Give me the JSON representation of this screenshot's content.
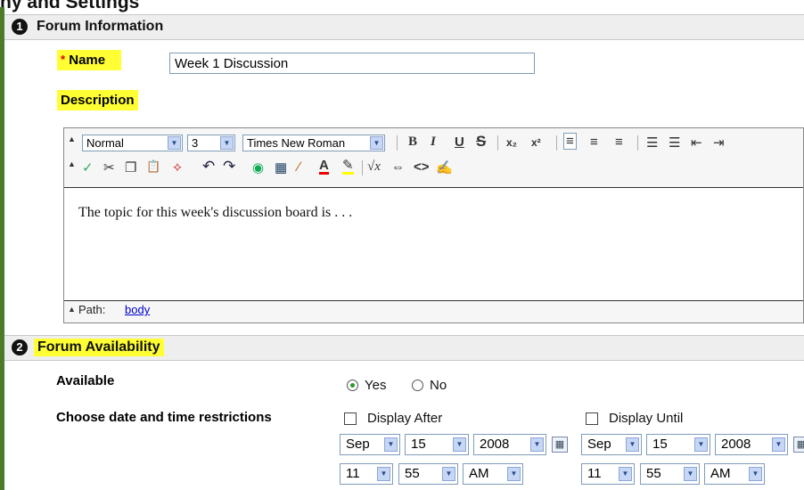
{
  "page_header_fragment": "ny and Settings",
  "section1": {
    "number": "1",
    "title": "Forum Information"
  },
  "name_field": {
    "required_mark": "*",
    "label": "Name",
    "value": "Week 1 Discussion"
  },
  "description": {
    "label": "Description"
  },
  "editor": {
    "format_select": "Normal",
    "size_select": "3",
    "font_select": "Times New Roman",
    "toolbar_row1": [
      {
        "name": "bold-icon",
        "glyph": "B"
      },
      {
        "name": "italic-icon",
        "glyph": "I"
      },
      {
        "name": "underline-icon",
        "glyph": "U"
      },
      {
        "name": "strikethrough-icon",
        "glyph": "S"
      },
      {
        "name": "subscript-icon",
        "glyph": "x₂"
      },
      {
        "name": "superscript-icon",
        "glyph": "x²"
      },
      {
        "name": "align-left-icon",
        "glyph": "≡"
      },
      {
        "name": "align-center-icon",
        "glyph": "≡"
      },
      {
        "name": "align-right-icon",
        "glyph": "≡"
      },
      {
        "name": "numbered-list-icon",
        "glyph": "☰"
      },
      {
        "name": "bullet-list-icon",
        "glyph": "☰"
      },
      {
        "name": "outdent-icon",
        "glyph": "⇤"
      },
      {
        "name": "indent-icon",
        "glyph": "⇥"
      }
    ],
    "toolbar_row2": [
      {
        "name": "spellcheck-icon",
        "glyph": "✓"
      },
      {
        "name": "cut-icon",
        "glyph": "✂"
      },
      {
        "name": "copy-icon",
        "glyph": "❐"
      },
      {
        "name": "paste-icon",
        "glyph": "📋"
      },
      {
        "name": "link-icon",
        "glyph": "⟡"
      },
      {
        "name": "undo-icon",
        "glyph": "↶"
      },
      {
        "name": "redo-icon",
        "glyph": "↷"
      },
      {
        "name": "image-icon",
        "glyph": "◉"
      },
      {
        "name": "table-icon",
        "glyph": "▦"
      },
      {
        "name": "line-icon",
        "glyph": "∕"
      },
      {
        "name": "text-color-icon",
        "glyph": "A"
      },
      {
        "name": "highlight-icon",
        "glyph": "✎"
      },
      {
        "name": "math-icon",
        "glyph": "√x"
      },
      {
        "name": "embed-icon",
        "glyph": "⇔"
      },
      {
        "name": "html-icon",
        "glyph": "<>"
      },
      {
        "name": "preview-icon",
        "glyph": "✍"
      }
    ],
    "content": "The topic for this week's discussion board is . . .",
    "path_label": "Path:",
    "path_value": "body"
  },
  "section2": {
    "number": "2",
    "title": "Forum Availability"
  },
  "availability": {
    "label": "Available",
    "yes": "Yes",
    "no": "No",
    "selected": "Yes"
  },
  "restrictions": {
    "label": "Choose date and time restrictions",
    "display_after": {
      "label": "Display After",
      "month": "Sep",
      "day": "15",
      "year": "2008",
      "hour": "11",
      "minute": "55",
      "ampm": "AM"
    },
    "display_until": {
      "label": "Display Until",
      "month": "Sep",
      "day": "15",
      "year": "2008",
      "hour": "11",
      "minute": "55",
      "ampm": "AM"
    }
  },
  "colors": {
    "highlight": "#ffff33",
    "frame_green": "#4a7a2a",
    "link": "#0000cc"
  }
}
